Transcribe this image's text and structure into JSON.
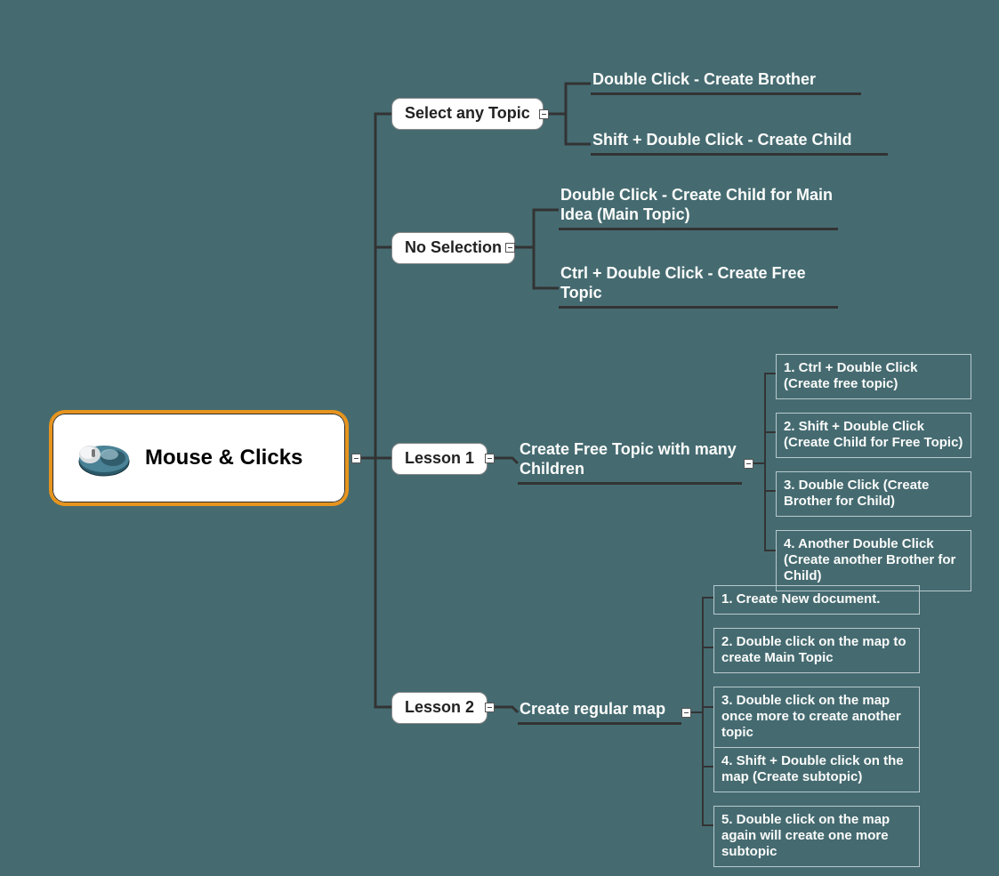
{
  "root": {
    "label": "Mouse & Clicks"
  },
  "branches": {
    "select_any_topic": {
      "label": "Select any Topic",
      "leaves": [
        "Double Click - Create Brother",
        "Shift + Double Click - Create Child"
      ]
    },
    "no_selection": {
      "label": "No Selection",
      "leaves": [
        "Double Click - Create Child for Main Idea (Main Topic)",
        "Ctrl + Double Click - Create Free Topic"
      ]
    },
    "lesson1": {
      "label": "Lesson 1",
      "sub": "Create Free Topic with many Children",
      "steps": [
        "1. Ctrl + Double Click (Create free topic)",
        "2. Shift + Double Click (Create Child for Free Topic)",
        "3. Double Click (Create Brother for Child)",
        "4. Another Double Click (Create another Brother for Child)"
      ]
    },
    "lesson2": {
      "label": "Lesson 2",
      "sub": "Create regular map",
      "steps": [
        "1. Create New document.",
        "2. Double click on the map to create Main Topic",
        "3. Double click on the map once more to create another topic",
        "4. Shift + Double click on the map (Create subtopic)",
        "5. Double click on the map again will create one more subtopic"
      ]
    }
  },
  "icons": {
    "root": "mouse-icon"
  },
  "colors": {
    "bg": "#456b71",
    "root_border": "#e6941e",
    "connector": "#333333",
    "leaf_text": "#fcfcfa",
    "step_border": "#b8c9cc"
  }
}
